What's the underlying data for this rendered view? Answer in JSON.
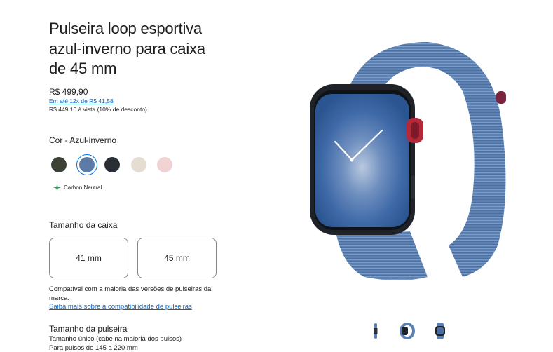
{
  "product": {
    "title_lines": [
      "Pulseira loop esportiva",
      "azul-inverno para caixa",
      "de 45 mm"
    ],
    "price": "R$ 499,90",
    "installments": "Em até 12x de R$ 41,58",
    "cash_price": "R$ 449,10 à vista (10% de desconto)"
  },
  "color": {
    "label": "Cor - Azul-inverno",
    "swatches": [
      {
        "name": "dark-olive",
        "hex": "#3c4236",
        "selected": false
      },
      {
        "name": "winter-blue",
        "hex": "#5c7ba6",
        "selected": true
      },
      {
        "name": "midnight",
        "hex": "#2a2f36",
        "selected": false
      },
      {
        "name": "light-beige",
        "hex": "#e6ddd2",
        "selected": false
      },
      {
        "name": "light-pink",
        "hex": "#f2d3d3",
        "selected": false
      }
    ],
    "carbon_neutral": "Carbon Neutral",
    "carbon_color": "#2e9e58"
  },
  "case_size": {
    "label": "Tamanho da caixa",
    "options": [
      "41 mm",
      "45 mm"
    ],
    "compat_text": "Compatível com a maioria das versões de pulseiras da marca.",
    "compat_link": "Saiba mais sobre a compatibilidade de pulseiras"
  },
  "band_size": {
    "label": "Tamanho da pulseira",
    "line1": "Tamanho único (cabe na maioria dos pulsos)",
    "line2": "Para pulsos de 145 a 220 mm"
  },
  "colors": {
    "link": "#0066cc",
    "ring": "#0071e3",
    "band": "#5a7fb0",
    "case": "#1f2329"
  }
}
